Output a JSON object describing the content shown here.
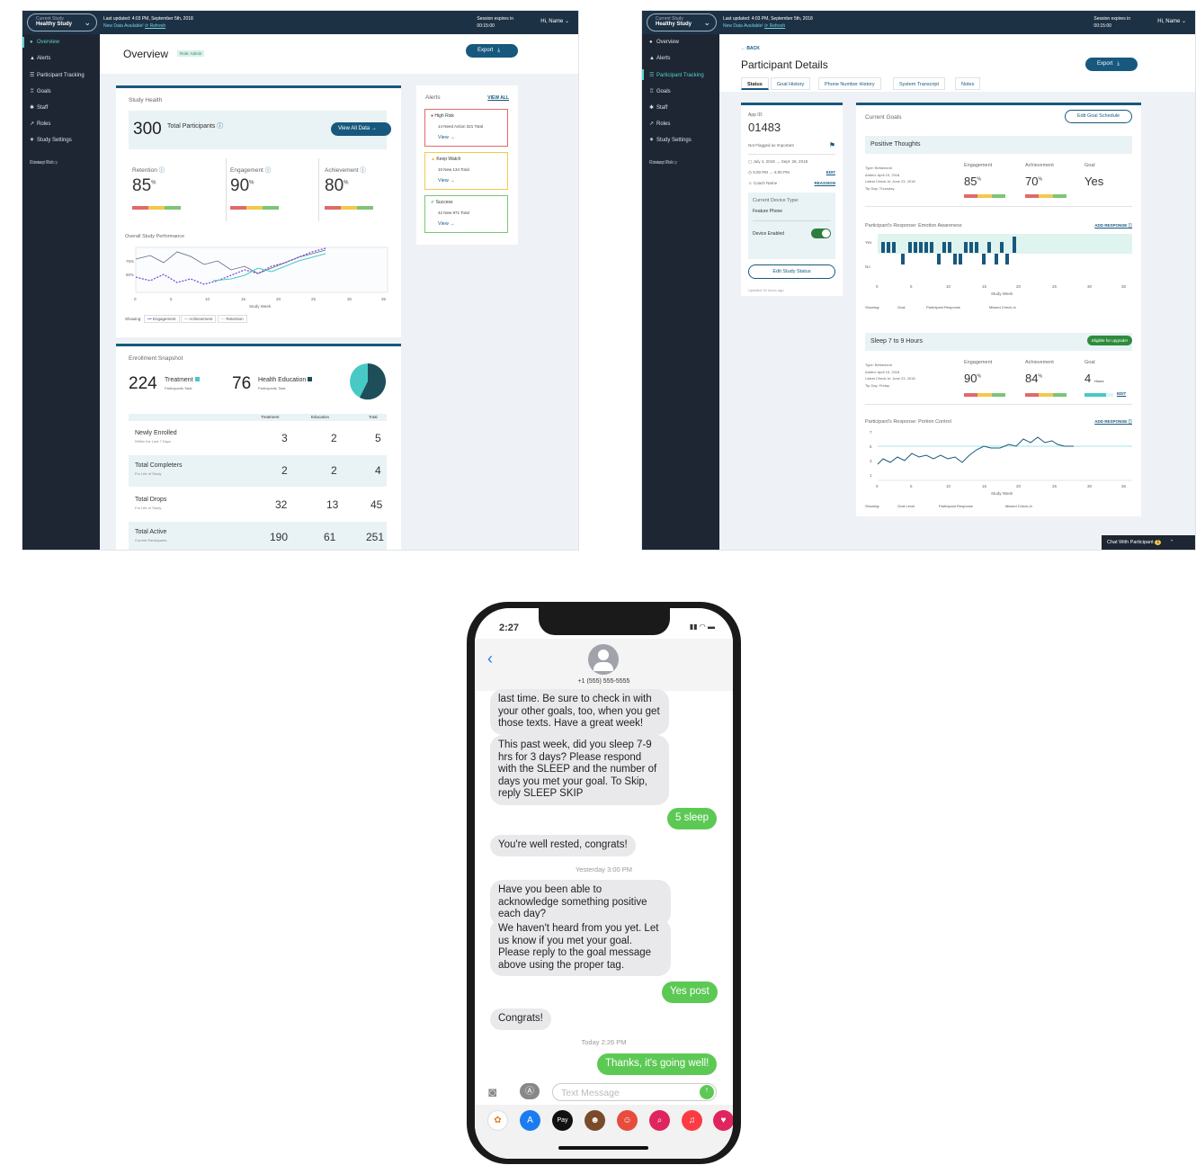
{
  "topbar": {
    "study_label": "Current Study",
    "study_name": "Healthy Study",
    "last_updated": "Last updated: 4:03 PM, September 5th, 2018",
    "new_data": "New Data Available!",
    "refresh": "Refresh",
    "session_label": "Session expires in",
    "session_time": "00:15:00",
    "greeting": "Hi, Name"
  },
  "sidebar": {
    "items": [
      "Overview",
      "Alerts",
      "Participant Tracking",
      "Goals",
      "Staff",
      "Roles",
      "Study Settings"
    ],
    "privacy": "Privacy Policy",
    "contact": "Contact Us"
  },
  "overview": {
    "title": "Overview",
    "role": "Role: Admin",
    "export": "Export",
    "study_health": "Study Health",
    "total_participants": "300",
    "total_label": "Total Participants",
    "view_all": "View All Data",
    "metrics": [
      {
        "label": "Retention",
        "value": "85"
      },
      {
        "label": "Engagement",
        "value": "90"
      },
      {
        "label": "Achievement",
        "value": "80"
      }
    ],
    "pct": "%",
    "perf_title": "Overall Study Performance",
    "perf_x_label": "Study Week",
    "perf_y_ticks": [
      "75%",
      "60%"
    ],
    "perf_x_ticks": [
      "0",
      "5",
      "10",
      "15",
      "20",
      "25",
      "30",
      "35"
    ],
    "showing": "Showing:",
    "legend": [
      "Engagement",
      "Achievement",
      "Retention"
    ],
    "alerts_title": "Alerts",
    "view_all_alerts": "VIEW ALL",
    "alerts": [
      {
        "title": "High Risk",
        "stats": "14 Need Action   321 Total",
        "view": "View",
        "color": "#c0392b"
      },
      {
        "title": "Keep Watch",
        "stats": "10 New   134 Total",
        "view": "View",
        "color": "#f1c40f"
      },
      {
        "title": "Success",
        "stats": "42 New   971 Total",
        "view": "View",
        "color": "#27ae60"
      }
    ],
    "enroll_title": "Enrollment Snapshot",
    "treatment_n": "224",
    "treatment_label": "Treatment",
    "treatment_sub": "Participants Total",
    "edu_n": "76",
    "edu_label": "Health Education",
    "edu_sub": "Participants Total",
    "table_headers": [
      "Treatment",
      "Education",
      "Total"
    ],
    "rows": [
      {
        "name": "Newly Enrolled",
        "sub": "Within the Last 7 Days",
        "t": "3",
        "e": "2",
        "tot": "5"
      },
      {
        "name": "Total Completers",
        "sub": "For Life of Study",
        "t": "2",
        "e": "2",
        "tot": "4"
      },
      {
        "name": "Total Drops",
        "sub": "For Life of Study",
        "t": "32",
        "e": "13",
        "tot": "45"
      },
      {
        "name": "Total Active",
        "sub": "Current Participants",
        "t": "190",
        "e": "61",
        "tot": "251"
      }
    ]
  },
  "details": {
    "back": "BACK",
    "title": "Participant Details",
    "export": "Export",
    "tabs": [
      "Status",
      "Goal History",
      "Phone Number History",
      "System Transcript",
      "Notes"
    ],
    "app_id_label": "App ID:",
    "app_id": "01483",
    "flag": "Not Flagged as Important",
    "dates": "July 4, 2018 → Sept. 26, 2018",
    "times": "5:00 PM → 6:00 PM",
    "edit": "EDIT",
    "coach": "Coach Name",
    "reassign": "REASSIGN",
    "device_type_label": "Current Device Type:",
    "device_type": "Feature Phone",
    "device_enabled": "Device Enabled",
    "edit_status": "Edit Study Status",
    "updated": "Updated 16 hours ago",
    "current_goals": "Current Goals",
    "edit_goal": "Edit Goal Schedule",
    "goal1": {
      "name": "Positive Thoughts",
      "type": "Type: Behavioral",
      "added": "Added: April 15, 2018",
      "checkin": "Latest Check-In: June 23, 2018",
      "tip": "Tip Day: Thursday",
      "eng": "85",
      "ach": "70",
      "goal": "Yes"
    },
    "resp1_title": "Participant's Response: Emotion Awareness",
    "add_response": "ADD RESPONSE",
    "goal2": {
      "name": "Sleep 7 to 9 Hours",
      "badge": "Eligible for upgrade!",
      "type": "Type: Behavioral",
      "added": "Added: April 15, 2018",
      "checkin": "Latest Check-In: June 23, 2018",
      "tip": "Tip Day: Friday",
      "eng": "90",
      "ach": "84",
      "goal": "4",
      "goal_unit": "Hours",
      "edit": "EDIT"
    },
    "resp2_title": "Participant's Response: Portion Control",
    "col_heads": [
      "Engagement",
      "Achievement",
      "Goal"
    ],
    "study_week": "Study Week",
    "showing": "Showing:",
    "legend1": [
      "Goal",
      "Participant Response",
      "Missed Check-In"
    ],
    "legend2": [
      "Goal Level",
      "Participant Response",
      "Missed Check-In"
    ],
    "y_yes": "Yes",
    "y_no": "No",
    "y_ticks2": [
      "7",
      "5",
      "3",
      "1"
    ],
    "x_ticks": [
      "0",
      "5",
      "10",
      "15",
      "20",
      "25",
      "30",
      "35"
    ],
    "chat": "Chat With Participant",
    "chat_count": "1"
  },
  "phone": {
    "time": "2:27",
    "contact": "+1 (555) 555-5555",
    "messages": [
      {
        "dir": "in",
        "text": "last time.  Be sure to check in with your other goals, too, when you get those texts. Have a great week!"
      },
      {
        "dir": "in",
        "text": "This past week, did you sleep 7-9 hrs for 3 days? Please respond with the SLEEP and the number of days you met your goal. To Skip, reply SLEEP SKIP"
      },
      {
        "dir": "out",
        "text": "5 sleep"
      },
      {
        "dir": "in",
        "text": "You're well rested, congrats!"
      },
      {
        "dir": "ts",
        "text": "Yesterday 3:00 PM"
      },
      {
        "dir": "in",
        "text": "Have you been able to acknowledge something positive each day?"
      },
      {
        "dir": "in",
        "text": "We haven't heard from you yet. Let us know if you met your goal. Please reply to the goal message above using the proper tag."
      },
      {
        "dir": "out",
        "text": "Yes post"
      },
      {
        "dir": "in",
        "text": "Congrats!"
      },
      {
        "dir": "ts",
        "text": "Today 2:26 PM"
      },
      {
        "dir": "out",
        "text": "Thanks, it's going well!"
      }
    ],
    "input_placeholder": "Text Message",
    "apps": [
      "photos-icon",
      "appstore-icon",
      "applepay-icon",
      "memoji-icon",
      "memoji2-icon",
      "search-icon",
      "music-icon",
      "heart-icon"
    ]
  }
}
